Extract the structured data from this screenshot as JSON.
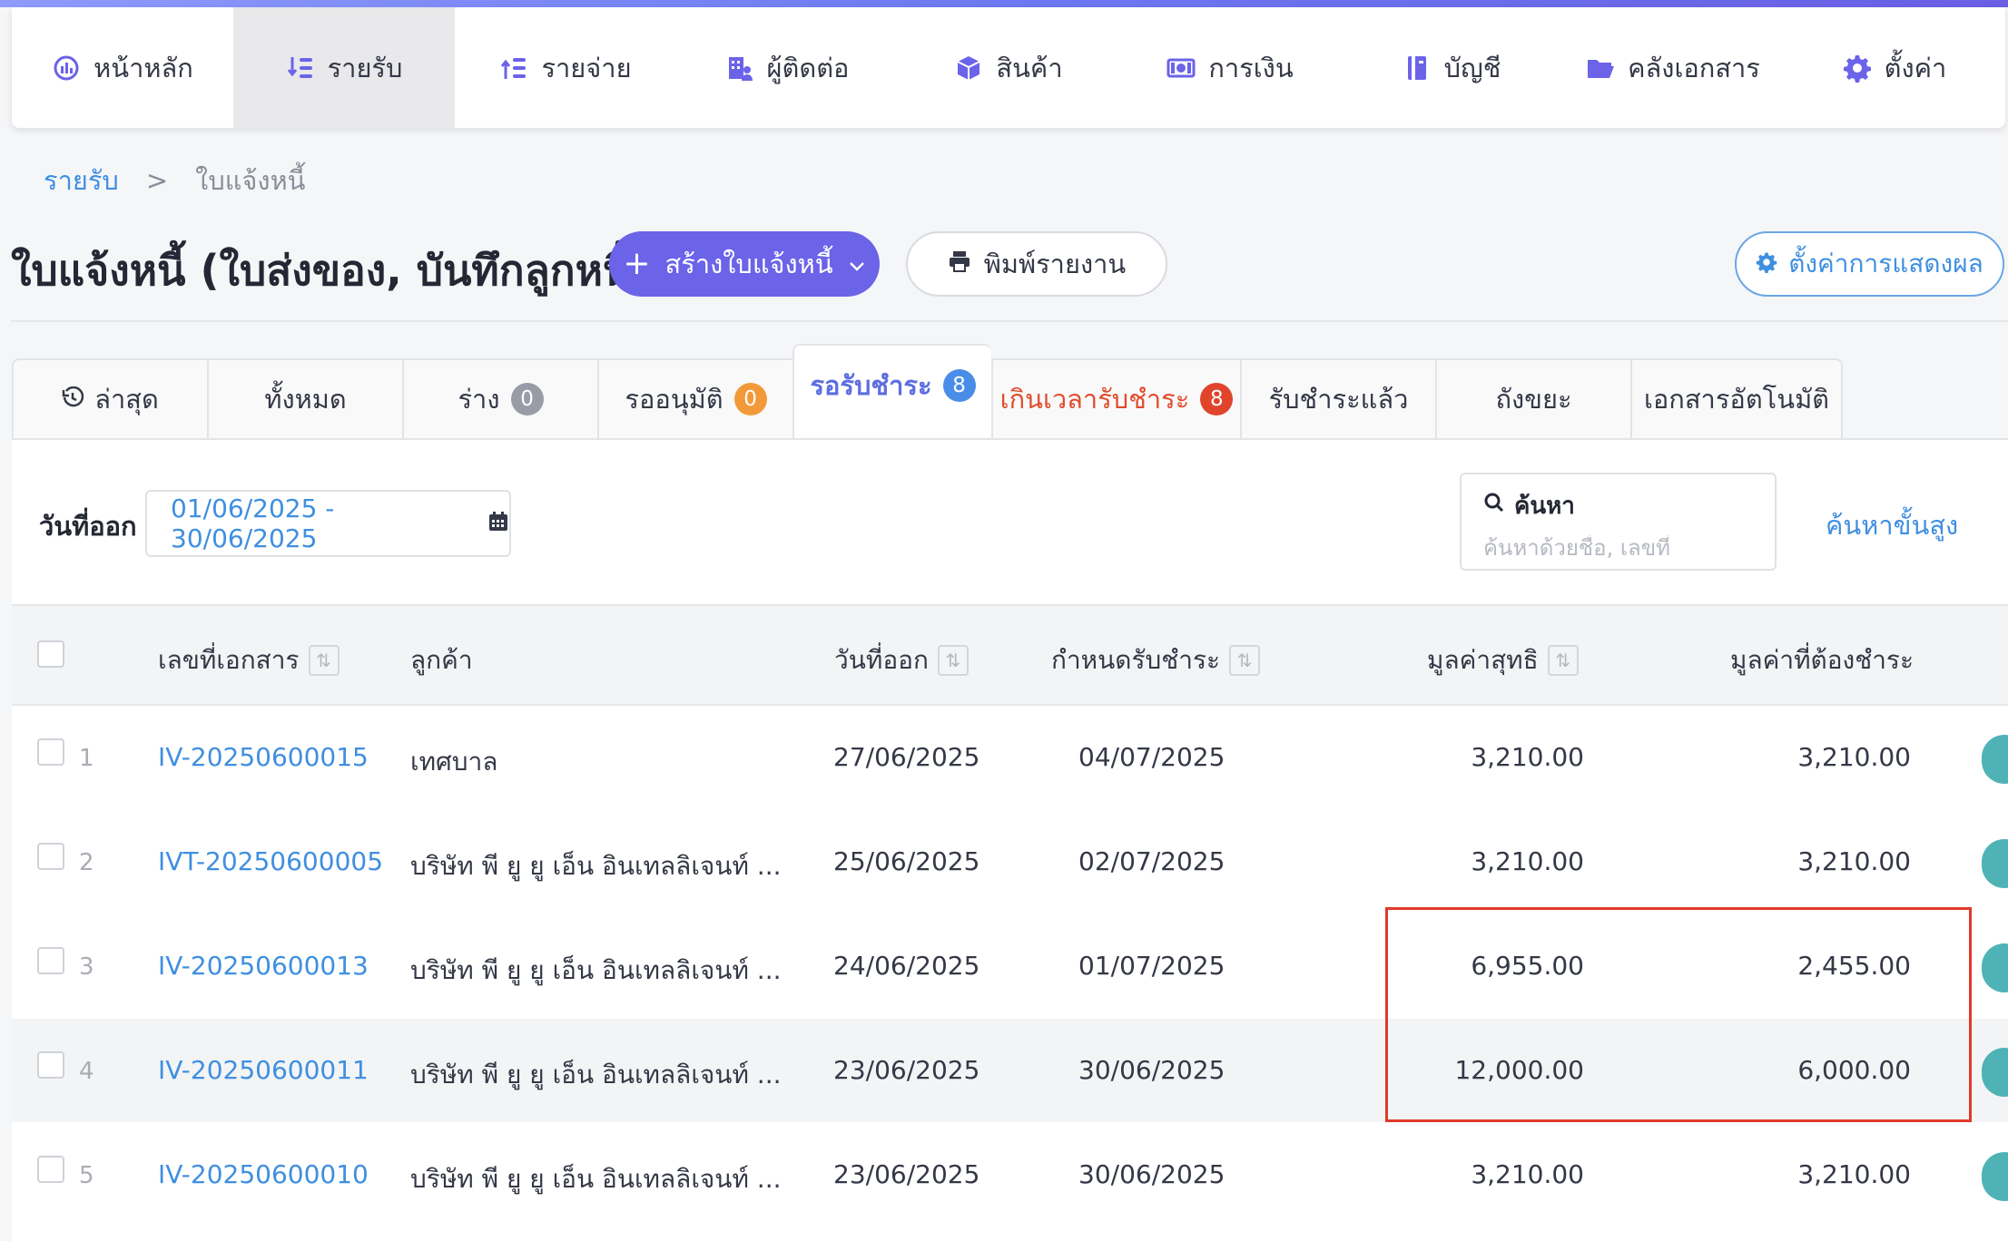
{
  "nav": {
    "items": [
      {
        "label": "หน้าหลัก",
        "icon": "dashboard-icon"
      },
      {
        "label": "รายรับ",
        "icon": "income-icon",
        "active": true
      },
      {
        "label": "รายจ่าย",
        "icon": "expense-icon"
      },
      {
        "label": "ผู้ติดต่อ",
        "icon": "contacts-icon"
      },
      {
        "label": "สินค้า",
        "icon": "box-icon"
      },
      {
        "label": "การเงิน",
        "icon": "money-icon"
      },
      {
        "label": "บัญชี",
        "icon": "ledger-icon"
      },
      {
        "label": "คลังเอกสาร",
        "icon": "folder-icon"
      },
      {
        "label": "ตั้งค่า",
        "icon": "gear-icon"
      }
    ]
  },
  "breadcrumb": {
    "parent": "รายรับ",
    "separator": ">",
    "current": "ใบแจ้งหนี้"
  },
  "header": {
    "title": "ใบแจ้งหนี้ (ใบส่งของ, บันทึกลูกหนี้)",
    "create_label": "สร้างใบแจ้งหนี้",
    "print_label": "พิมพ์รายงาน",
    "display_settings_label": "ตั้งค่าการแสดงผล"
  },
  "tabs": [
    {
      "label": "ล่าสุด",
      "icon": "history-icon"
    },
    {
      "label": "ทั้งหมด"
    },
    {
      "label": "ร่าง",
      "badge": "0",
      "badge_color": "#999ca6"
    },
    {
      "label": "รออนุมัติ",
      "badge": "0",
      "badge_color": "#f29a3a"
    },
    {
      "label": "รอรับชำระ",
      "badge": "8",
      "badge_color": "#4a8de8",
      "active": true
    },
    {
      "label": "เกินเวลารับชำระ",
      "badge": "8",
      "badge_color": "#e0452b",
      "overdue": true
    },
    {
      "label": "รับชำระแล้ว"
    },
    {
      "label": "ถังขยะ"
    },
    {
      "label": "เอกสารอัตโนมัติ"
    }
  ],
  "filter": {
    "date_label": "วันที่ออก",
    "date_range": "01/06/2025 - 30/06/2025",
    "search_label": "ค้นหา",
    "search_placeholder": "ค้นหาด้วยชื่อ, เลขที่",
    "search_value": "",
    "advanced_label": "ค้นหาขั้นสูง"
  },
  "table": {
    "columns": {
      "doc_no": "เลขที่เอกสาร",
      "customer": "ลูกค้า",
      "issue_date": "วันที่ออก",
      "due_date": "กำหนดรับชำระ",
      "net_amount": "มูลค่าสุทธิ",
      "amount_due": "มูลค่าที่ต้องชำระ"
    },
    "rows": [
      {
        "num": "1",
        "doc_no": "IV-20250600015",
        "customer": "เทศบาล",
        "issue_date": "27/06/2025",
        "due_date": "04/07/2025",
        "net_amount": "3,210.00",
        "amount_due": "3,210.00"
      },
      {
        "num": "2",
        "doc_no": "IVT-20250600005",
        "customer": "บริษัท พี ยู ยู เอ็น อินเทลลิเจนท์ ...",
        "issue_date": "25/06/2025",
        "due_date": "02/07/2025",
        "net_amount": "3,210.00",
        "amount_due": "3,210.00"
      },
      {
        "num": "3",
        "doc_no": "IV-20250600013",
        "customer": "บริษัท พี ยู ยู เอ็น อินเทลลิเจนท์ ...",
        "issue_date": "24/06/2025",
        "due_date": "01/07/2025",
        "net_amount": "6,955.00",
        "amount_due": "2,455.00"
      },
      {
        "num": "4",
        "doc_no": "IV-20250600011",
        "customer": "บริษัท พี ยู ยู เอ็น อินเทลลิเจนท์ ...",
        "issue_date": "23/06/2025",
        "due_date": "30/06/2025",
        "net_amount": "12,000.00",
        "amount_due": "6,000.00"
      },
      {
        "num": "5",
        "doc_no": "IV-20250600010",
        "customer": "บริษัท พี ยู ยู เอ็น อินเทลลิเจนท์ ...",
        "issue_date": "23/06/2025",
        "due_date": "30/06/2025",
        "net_amount": "3,210.00",
        "amount_due": "3,210.00"
      }
    ]
  },
  "colors": {
    "accent": "#6b63e8",
    "link": "#3f8fe0",
    "overdue": "#e24b2d",
    "highlight_box": "#e0392b",
    "row_action": "#4fb3b6"
  }
}
